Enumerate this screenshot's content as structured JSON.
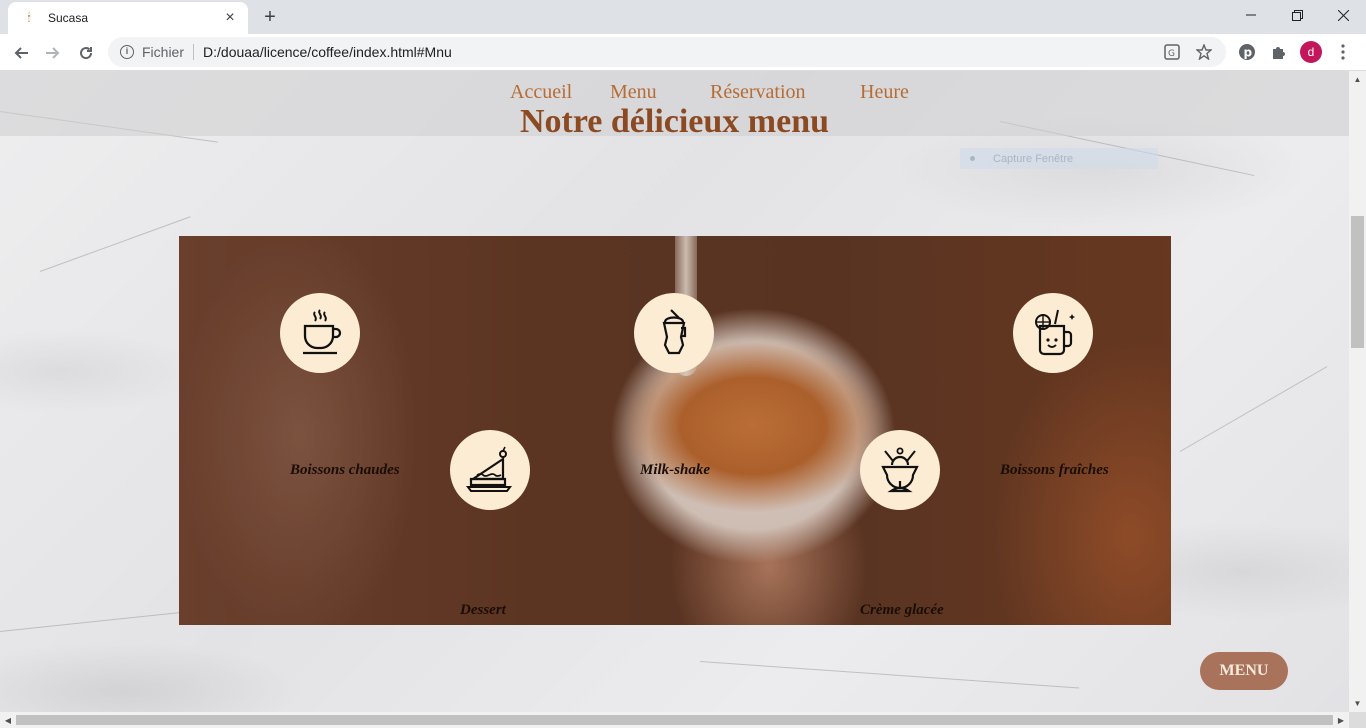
{
  "browser": {
    "tab_title": "Sucasa",
    "tab_favicon": "🕯",
    "new_tab_label": "+",
    "omnibox_scheme": "Fichier",
    "omnibox_url": "D:/douaa/licence/coffee/index.html#Mnu",
    "profile_initial": "d"
  },
  "nav": {
    "links": [
      "Accueil",
      "Menu",
      "Réservation",
      "Heure"
    ]
  },
  "page": {
    "title": "Notre délicieux menu",
    "ghost_text": "Capture Fenêtre"
  },
  "categories": [
    {
      "label": "Boissons chaudes",
      "icon": "hot-coffee-cup-icon"
    },
    {
      "label": "Milk-shake",
      "icon": "milkshake-icon"
    },
    {
      "label": "Boissons fraîches",
      "icon": "cold-drink-jar-icon"
    },
    {
      "label": "Dessert",
      "icon": "cake-slice-icon"
    },
    {
      "label": "Crème glacée",
      "icon": "ice-cream-sundae-icon"
    }
  ],
  "menu_button_label": "MENU",
  "colors": {
    "nav_link": "#b66c35",
    "title": "#8c4a22",
    "icon_bg": "#fbecd3",
    "menu_button": "#a9725a"
  }
}
